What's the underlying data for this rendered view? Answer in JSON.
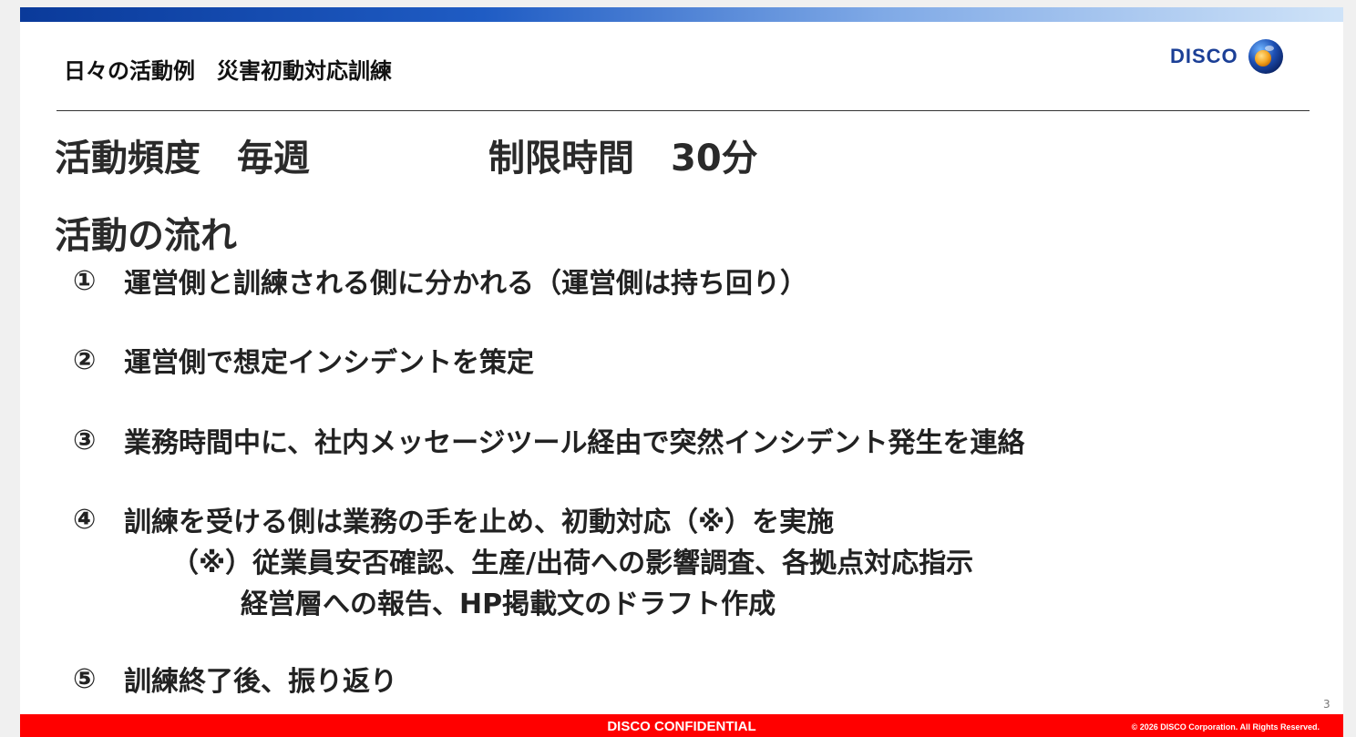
{
  "slide": {
    "title": "日々の活動例　災害初動対応訓練",
    "logo_text": "DISCO",
    "frequency": "活動頻度　毎週",
    "time_limit": "制限時間　30分",
    "flow_heading": "活動の流れ",
    "steps": [
      {
        "num": "①",
        "text": "運営側と訓練される側に分かれる（運営側は持ち回り）"
      },
      {
        "num": "②",
        "text": "運営側で想定インシデントを策定"
      },
      {
        "num": "③",
        "text": "業務時間中に、社内メッセージツール経由で突然インシデント発生を連絡"
      },
      {
        "num": "④",
        "text": "訓練を受ける側は業務の手を止め、初動対応（※）を実施"
      },
      {
        "num": "⑤",
        "text": "訓練終了後、振り返り"
      }
    ],
    "note_line1": "（※）従業員安否確認、生産/出荷への影響調査、各拠点対応指示",
    "note_line2": "経営層への報告、HP掲載文のドラフト作成",
    "page_number": "3"
  },
  "footer": {
    "confidential": "DISCO CONFIDENTIAL",
    "copyright": "© 2026 DISCO Corporation. All Rights Reserved."
  },
  "colors": {
    "brand_blue": "#1b3f96",
    "footer_red": "#ff0000",
    "logo_orange": "#f5a623"
  },
  "icons": {
    "logo": "disco-sphere-logo-icon"
  }
}
